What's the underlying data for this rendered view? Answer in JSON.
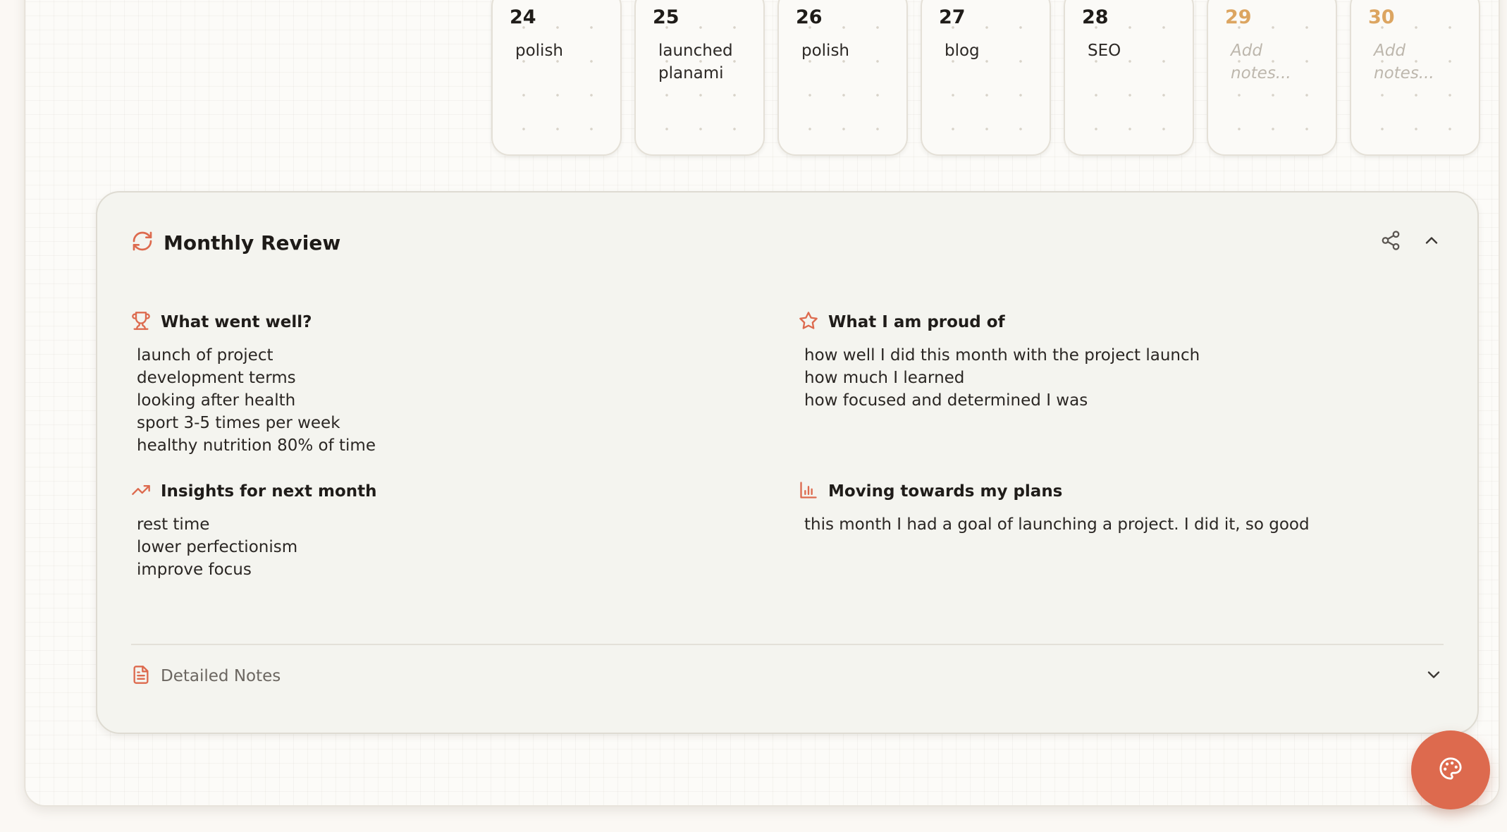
{
  "calendar": {
    "days": [
      {
        "number": "24",
        "note": "polish",
        "future": false
      },
      {
        "number": "25",
        "note": "launched planami",
        "future": false
      },
      {
        "number": "26",
        "note": "polish",
        "future": false
      },
      {
        "number": "27",
        "note": "blog",
        "future": false
      },
      {
        "number": "28",
        "note": "SEO",
        "future": false
      },
      {
        "number": "29",
        "note": "",
        "placeholder": "Add notes...",
        "future": true
      },
      {
        "number": "30",
        "note": "",
        "placeholder": "Add notes...",
        "future": true
      }
    ]
  },
  "review": {
    "title": "Monthly Review",
    "title_icon": "refresh-icon",
    "actions": {
      "share_icon": "share-icon",
      "collapse_icon": "chevron-up-icon"
    },
    "sections": {
      "went_well": {
        "title": "What went well?",
        "icon": "trophy-icon",
        "items": [
          "launch of project",
          "development terms",
          "looking after health",
          "sport 3-5 times per week",
          "healthy nutrition 80% of time"
        ]
      },
      "proud_of": {
        "title": "What I am proud of",
        "icon": "star-icon",
        "items": [
          "how well I did this month with the project launch",
          "how much I learned",
          "how focused and determined I was"
        ]
      },
      "insights": {
        "title": "Insights for next month",
        "icon": "trending-up-icon",
        "items": [
          "rest time",
          "lower perfectionism",
          "improve focus"
        ]
      },
      "plans": {
        "title": "Moving towards my plans",
        "icon": "bar-chart-icon",
        "items": [
          "this month I had a goal of launching a project. I did it, so good"
        ]
      }
    },
    "detailed_notes": {
      "label": "Detailed Notes",
      "icon": "file-text-icon",
      "toggle_icon": "chevron-down-icon"
    }
  },
  "fab": {
    "icon": "palette-icon"
  },
  "colors": {
    "accent": "#dd6a4e",
    "future_day": "#dca561",
    "background": "#fbf8f4",
    "card": "#f4f4ef"
  }
}
